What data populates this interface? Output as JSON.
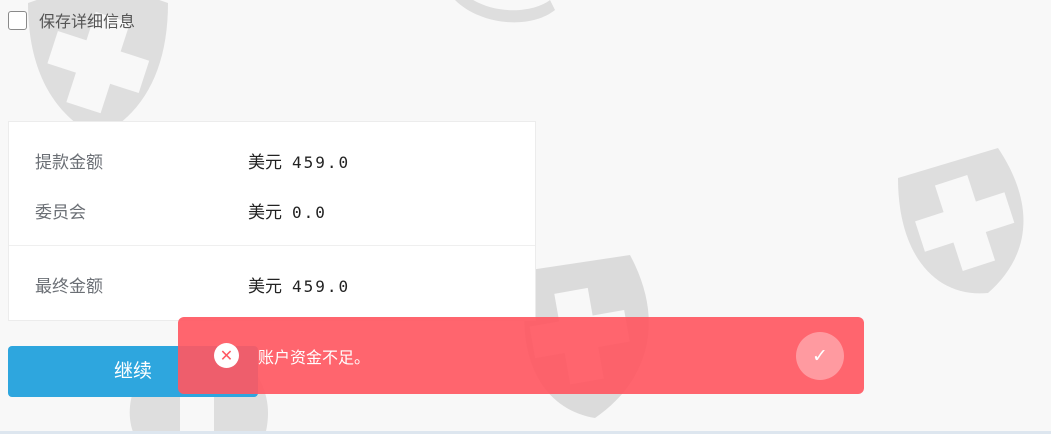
{
  "form": {
    "save_details_label": "保存详细信息",
    "save_details_checked": false
  },
  "summary": {
    "rows": [
      {
        "label": "提款金额",
        "currency": "美元",
        "amount": "459.0"
      },
      {
        "label": "委员会",
        "currency": "美元",
        "amount": "0.0"
      },
      {
        "label": "最终金额",
        "currency": "美元",
        "amount": "459.0"
      }
    ]
  },
  "actions": {
    "continue_label": "继续"
  },
  "toast": {
    "message": "账户资金不足。",
    "error_icon": "close-circle-icon",
    "confirm_icon": "check-icon",
    "background": "#ff5862"
  },
  "colors": {
    "primary": "#2ea6de",
    "watermark": "#cfcfcf"
  }
}
